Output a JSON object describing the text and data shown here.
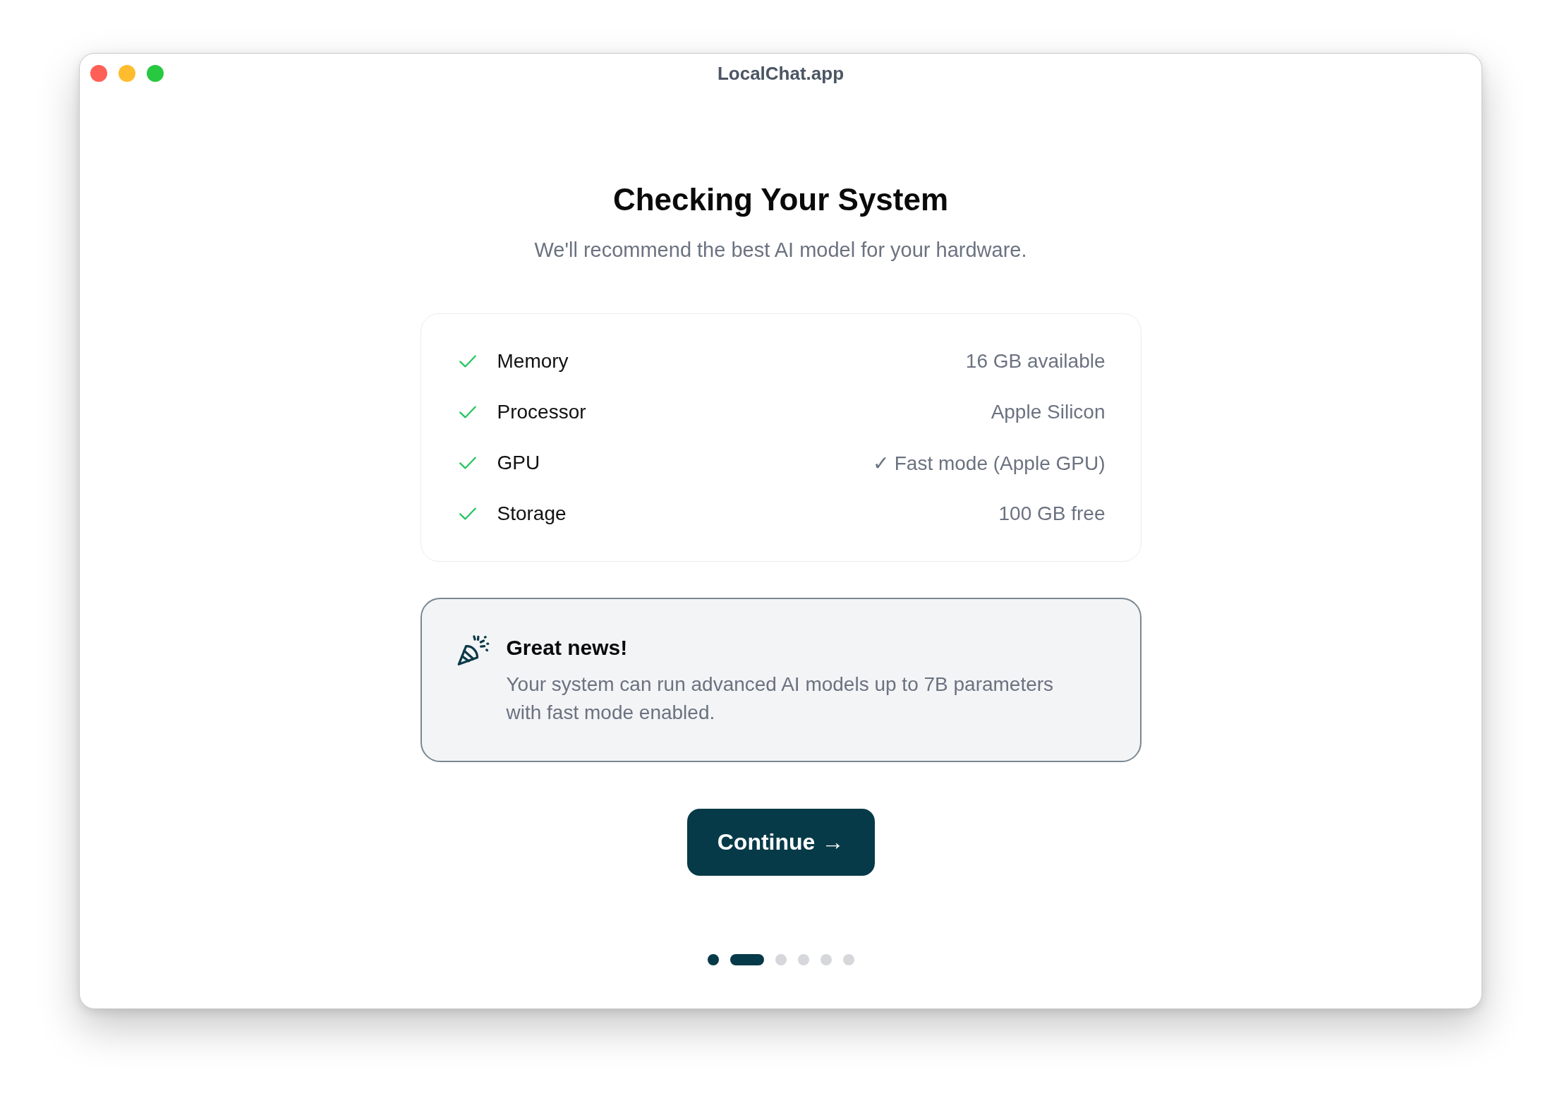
{
  "window": {
    "title": "LocalChat.app"
  },
  "heading": "Checking Your System",
  "subtitle": "We'll recommend the best AI model for your hardware.",
  "checks": [
    {
      "label": "Memory",
      "value": "16 GB available",
      "passed": true
    },
    {
      "label": "Processor",
      "value": "Apple Silicon",
      "passed": true
    },
    {
      "label": "GPU",
      "value": "✓ Fast mode (Apple GPU)",
      "passed": true
    },
    {
      "label": "Storage",
      "value": "100 GB free",
      "passed": true
    }
  ],
  "notice": {
    "title": "Great news!",
    "text": "Your system can run advanced AI models up to 7B parameters with fast mode enabled."
  },
  "primary_button": {
    "label": "Continue →"
  },
  "steps": [
    {
      "kind": "done"
    },
    {
      "kind": "current"
    },
    {
      "kind": "pending"
    },
    {
      "kind": "pending"
    },
    {
      "kind": "pending"
    },
    {
      "kind": "pending"
    }
  ]
}
